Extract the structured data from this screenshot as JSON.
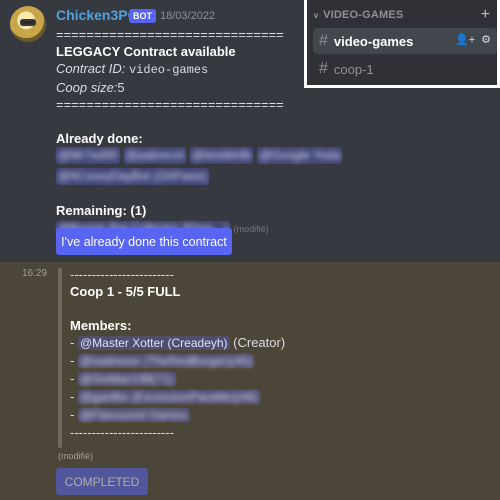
{
  "message1": {
    "author": "Chicken3PO",
    "bot_badge": "BOT",
    "timestamp": "18/03/2022",
    "separator": "==============================",
    "title": "LEGGACY Contract available",
    "contract_id_label": "Contract ID:",
    "contract_id_value": "video-games",
    "coop_size_label": "Coop size:",
    "coop_size_value": "5",
    "already_done_label": "Already done:",
    "already_done_mentions": [
      "@Mr7ed00",
      "@pabrecol",
      "@bestkk9k",
      "@Google Yoda",
      "@ItCoveyDayBot (GhPaws)"
    ],
    "remaining_label": "Remaining: (1)",
    "remaining_mentions": [
      "@Bossin Bat Collector (Khan...)"
    ],
    "edited_label": "(modifié)",
    "button_label": "I've already done this contract"
  },
  "message2": {
    "timestamp": "16:29",
    "dash_line": "------------------------",
    "coop_title": "Coop 1 - 5/5 FULL",
    "members_label": "Members:",
    "creator_mention": "@Master Xotter (Creadeyh)",
    "creator_suffix": "(Creator)",
    "member_mentions": [
      "@sadnessr (TheRedBurger)(45)",
      "@SixMan198(71)",
      "@ganfbo (ExcessiveParaMe)(49)",
      "@Flavoured Games"
    ],
    "bullet": "-",
    "edited_label": "(modifié)",
    "button_label": "COMPLETED"
  },
  "channel_popup": {
    "category": "VIDEO-GAMES",
    "plus_icon": "+",
    "channels": [
      {
        "name": "video-games",
        "active": true
      },
      {
        "name": "coop-1",
        "active": false
      }
    ]
  },
  "colors": {
    "background": "#36393f",
    "highlight_message": "#4b4637",
    "blurple": "#5865f2",
    "author": "#4fa3e0"
  }
}
